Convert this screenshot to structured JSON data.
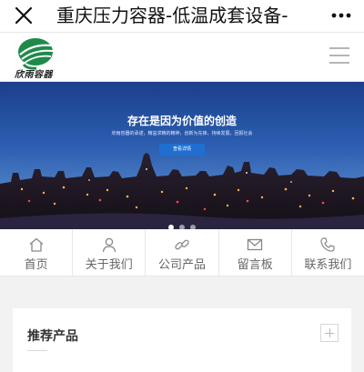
{
  "topbar": {
    "title": "重庆压力容器-低温成套设备-",
    "close_icon": "close-icon",
    "more_icon": "more-dots-icon"
  },
  "header": {
    "logo_text": "欣雨容器",
    "logo_icon": "leaf-logo-icon",
    "menu_icon": "hamburger-menu-icon"
  },
  "banner": {
    "title": "存在是因为价值的创造",
    "subtitle": "欣雨容器的承诺，精益求精的精神，创新为先锋，持续发展，回报社会",
    "button_label": "查看详情",
    "colors": {
      "sky_top": "#1b3f8c",
      "horizon": "#f07a3a",
      "city": "#201a24"
    }
  },
  "nav": {
    "items": [
      {
        "label": "首页",
        "icon": "home-icon"
      },
      {
        "label": "关于我们",
        "icon": "user-icon"
      },
      {
        "label": "公司产品",
        "icon": "link-icon"
      },
      {
        "label": "留言板",
        "icon": "mail-icon"
      },
      {
        "label": "联系我们",
        "icon": "phone-icon"
      }
    ]
  },
  "products": {
    "title": "推荐产品",
    "more_icon": "plus-icon"
  }
}
